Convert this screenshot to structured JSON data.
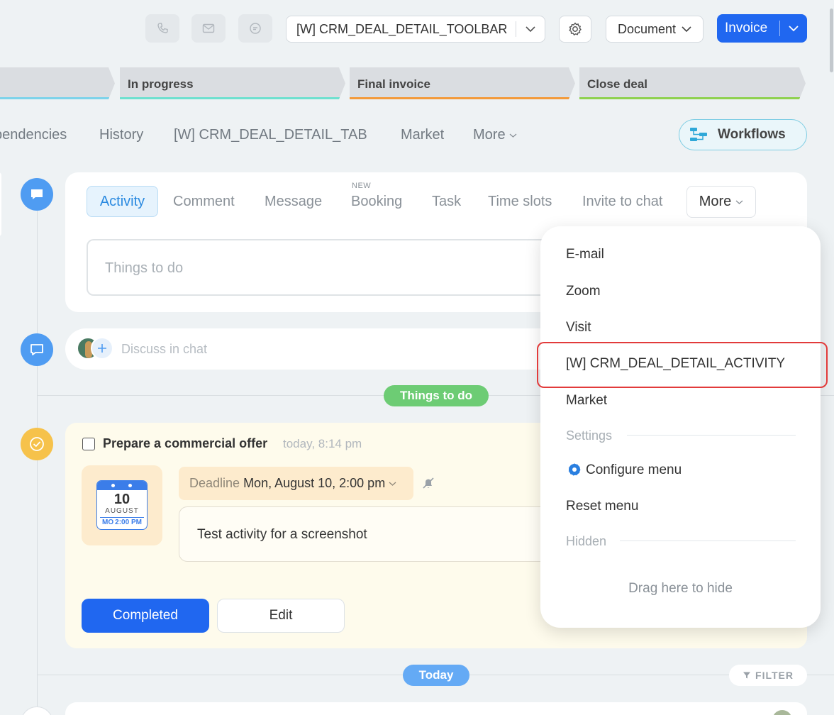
{
  "toolbar": {
    "toolbar_select": "[W] CRM_DEAL_DETAIL_TOOLBAR",
    "document_label": "Document",
    "invoice_label": "Invoice"
  },
  "stages": [
    "In progress",
    "Final invoice",
    "Close deal"
  ],
  "tabs": {
    "partial_dependencies": "pendencies",
    "history": "History",
    "widget_tab": "[W] CRM_DEAL_DETAIL_TAB",
    "market": "Market",
    "more": "More",
    "workflows": "Workflows"
  },
  "editor": {
    "tabs": {
      "activity": "Activity",
      "comment": "Comment",
      "message": "Message",
      "booking": "Booking",
      "booking_badge": "NEW",
      "task": "Task",
      "time_slots": "Time slots",
      "invite_to_chat": "Invite to chat",
      "more": "More"
    },
    "placeholder": "Things to do"
  },
  "chat": {
    "placeholder": "Discuss in chat"
  },
  "timeline": {
    "things_to_do_label": "Things to do",
    "today_label": "Today",
    "filter_label": "FILTER"
  },
  "activity": {
    "title": "Prepare a commercial offer",
    "time": "today, 8:14 pm",
    "calendar": {
      "day": "10",
      "month": "AUGUST",
      "weekday": "MO",
      "time": "2:00 PM"
    },
    "deadline_label": "Deadline",
    "deadline_value": "Mon, August 10, 2:00 pm",
    "description": "Test activity for a screenshot",
    "completed_label": "Completed",
    "edit_label": "Edit"
  },
  "menu": {
    "items": [
      "E-mail",
      "Zoom",
      "Visit",
      "[W] CRM_DEAL_DETAIL_ACTIVITY",
      "Market"
    ],
    "settings_label": "Settings",
    "configure_label": "Configure menu",
    "reset_label": "Reset menu",
    "hidden_label": "Hidden",
    "drag_hint": "Drag here to hide"
  },
  "colors": {
    "accent": "#2067f0",
    "timeline_blue": "#4f9cf2",
    "todo_green": "#6dcc74",
    "today_blue": "#64aaf5",
    "activity_yellow": "#f6c24b",
    "highlight_red": "#e23b3b"
  },
  "icons": [
    "phone-icon",
    "mail-icon",
    "chat-refresh-icon",
    "chevron-down-icon",
    "gear-icon",
    "workflows-icon",
    "comment-icon",
    "chat-bubble-icon",
    "check-circle-icon",
    "bell-off-icon",
    "filter-icon",
    "calendar-icon",
    "plus-icon",
    "avatar"
  ]
}
